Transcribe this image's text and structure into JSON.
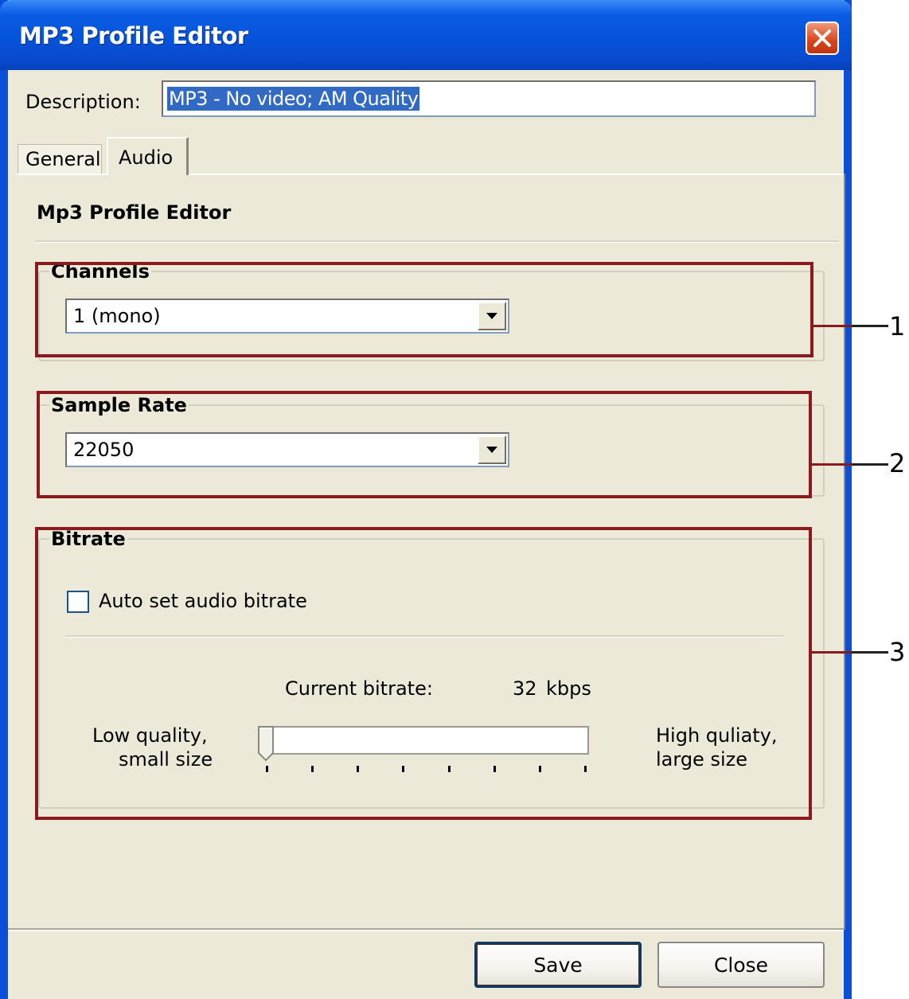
{
  "window": {
    "title": "MP3 Profile Editor",
    "close_icon": "close-x-icon"
  },
  "description": {
    "label": "Description:",
    "value": "MP3 - No video; AM Quality"
  },
  "tabs": [
    {
      "label": "General",
      "active": false
    },
    {
      "label": "Audio",
      "active": true
    }
  ],
  "panel": {
    "heading": "Mp3 Profile Editor"
  },
  "channels": {
    "group_label": "Channels",
    "selected": "1 (mono)"
  },
  "sample_rate": {
    "group_label": "Sample Rate",
    "selected": "22050"
  },
  "bitrate": {
    "group_label": "Bitrate",
    "auto_label": "Auto set audio bitrate",
    "auto_checked": false,
    "current_label": "Current bitrate:",
    "current_value": "32",
    "current_unit": "kbps",
    "low_label_1": "Low quality,",
    "low_label_2": "small size",
    "high_label_1": "High quliaty,",
    "high_label_2": "large size",
    "slider_position": 0,
    "tick_count": 8
  },
  "callouts": [
    "1",
    "2",
    "3"
  ],
  "buttons": {
    "save": "Save",
    "close": "Close"
  },
  "colors": {
    "titlebar": "#0553d9",
    "dialog_bg": "#ece9d8",
    "callout_box": "#8b1a1f",
    "selection": "#316ac5"
  }
}
